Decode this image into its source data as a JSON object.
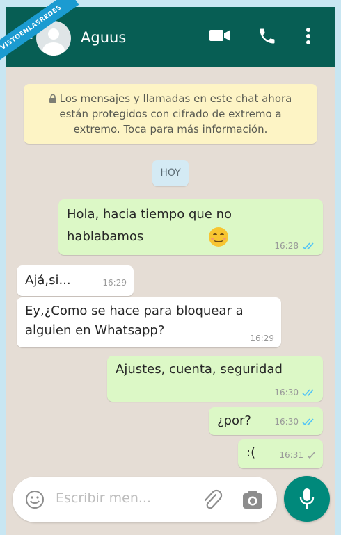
{
  "watermark": {
    "text": "VISTOENLASREDES"
  },
  "header": {
    "contact_name": "Aguus"
  },
  "notice": {
    "text": "Los mensajes y llamadas en este chat ahora están protegidos con cifrado de extremo a extremo. Toca para más información."
  },
  "date_chip": {
    "label": "HOY"
  },
  "messages": [
    {
      "direction": "outgoing",
      "text": "Hola, hacia tiempo que no hablabamos",
      "emoji": "smiling-face-emoji",
      "time": "16:28",
      "status": "read"
    },
    {
      "direction": "incoming",
      "text": "Ajá,si...",
      "time": "16:29"
    },
    {
      "direction": "incoming",
      "text": "Ey,¿Como se hace para bloquear a alguien en Whatsapp?",
      "time": "16:29"
    },
    {
      "direction": "outgoing",
      "text": "Ajustes, cuenta, seguridad",
      "time": "16:30",
      "status": "read"
    },
    {
      "direction": "outgoing",
      "text": "¿por?",
      "time": "16:30",
      "status": "read"
    },
    {
      "direction": "outgoing",
      "text": ":(",
      "time": "16:31",
      "status": "delivered"
    }
  ],
  "composer": {
    "placeholder": "Escribir men..."
  },
  "colors": {
    "header": "#075e54",
    "outgoing_bubble": "#dcf8c6",
    "incoming_bubble": "#ffffff",
    "notice": "#fdf4c5",
    "read_check": "#4fc3f7",
    "mic_button": "#00897b"
  },
  "icons": [
    "back-arrow-icon",
    "avatar",
    "video-call-icon",
    "phone-icon",
    "more-options-icon",
    "lock-icon",
    "emoji-icon",
    "attach-icon",
    "camera-icon",
    "mic-icon"
  ]
}
